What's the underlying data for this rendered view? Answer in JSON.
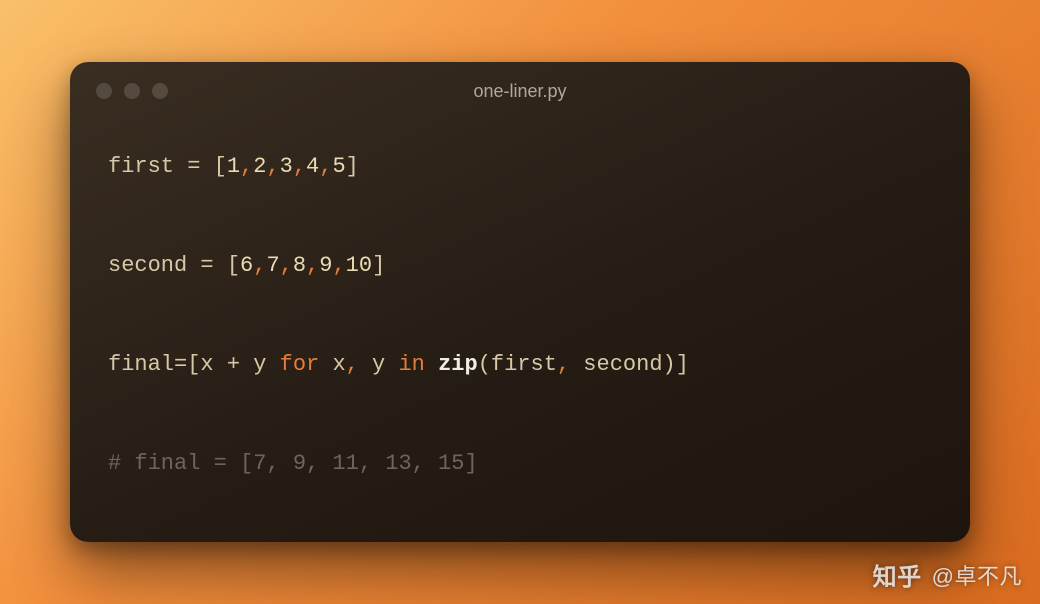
{
  "window": {
    "title": "one-liner.py"
  },
  "code": {
    "lines": [
      [
        {
          "cls": "t-ident",
          "text": "first"
        },
        {
          "cls": "t-op",
          "text": " = "
        },
        {
          "cls": "t-punc",
          "text": "["
        },
        {
          "cls": "t-num",
          "text": "1"
        },
        {
          "cls": "t-comma",
          "text": ","
        },
        {
          "cls": "t-num",
          "text": "2"
        },
        {
          "cls": "t-comma",
          "text": ","
        },
        {
          "cls": "t-num",
          "text": "3"
        },
        {
          "cls": "t-comma",
          "text": ","
        },
        {
          "cls": "t-num",
          "text": "4"
        },
        {
          "cls": "t-comma",
          "text": ","
        },
        {
          "cls": "t-num",
          "text": "5"
        },
        {
          "cls": "t-punc",
          "text": "]"
        }
      ],
      [],
      [
        {
          "cls": "t-ident",
          "text": "second"
        },
        {
          "cls": "t-op",
          "text": " = "
        },
        {
          "cls": "t-punc",
          "text": "["
        },
        {
          "cls": "t-num",
          "text": "6"
        },
        {
          "cls": "t-comma",
          "text": ","
        },
        {
          "cls": "t-num",
          "text": "7"
        },
        {
          "cls": "t-comma",
          "text": ","
        },
        {
          "cls": "t-num",
          "text": "8"
        },
        {
          "cls": "t-comma",
          "text": ","
        },
        {
          "cls": "t-num",
          "text": "9"
        },
        {
          "cls": "t-comma",
          "text": ","
        },
        {
          "cls": "t-num",
          "text": "10"
        },
        {
          "cls": "t-punc",
          "text": "]"
        }
      ],
      [],
      [
        {
          "cls": "t-ident",
          "text": "final"
        },
        {
          "cls": "t-op",
          "text": "="
        },
        {
          "cls": "t-punc",
          "text": "["
        },
        {
          "cls": "t-ident",
          "text": "x "
        },
        {
          "cls": "t-op",
          "text": "+"
        },
        {
          "cls": "t-ident",
          "text": " y "
        },
        {
          "cls": "t-kw",
          "text": "for"
        },
        {
          "cls": "t-ident",
          "text": " x"
        },
        {
          "cls": "t-comma",
          "text": ","
        },
        {
          "cls": "t-ident",
          "text": " y "
        },
        {
          "cls": "t-kw",
          "text": "in"
        },
        {
          "cls": "t-ident",
          "text": " "
        },
        {
          "cls": "t-fn",
          "text": "zip"
        },
        {
          "cls": "t-paren",
          "text": "("
        },
        {
          "cls": "t-ident",
          "text": "first"
        },
        {
          "cls": "t-comma",
          "text": ","
        },
        {
          "cls": "t-ident",
          "text": " second"
        },
        {
          "cls": "t-paren",
          "text": ")"
        },
        {
          "cls": "t-punc",
          "text": "]"
        }
      ],
      [],
      [
        {
          "cls": "t-comment",
          "text": "# final = [7, 9, 11, 13, 15]"
        }
      ]
    ]
  },
  "watermark": {
    "logo": "知乎",
    "author": "@卓不凡"
  }
}
